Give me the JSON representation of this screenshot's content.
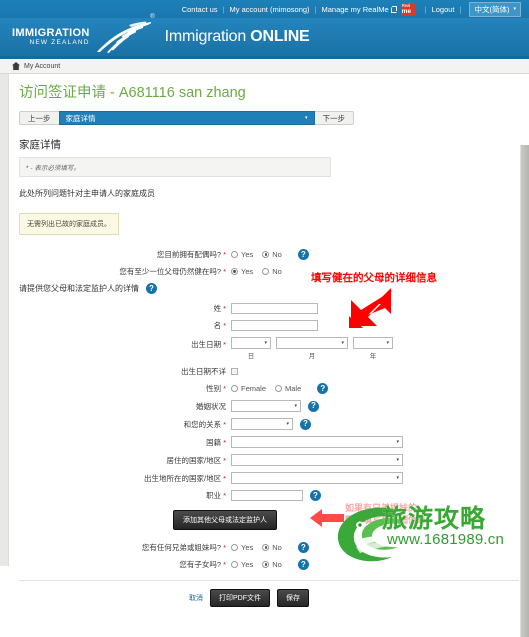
{
  "topbar": {
    "links": [
      {
        "label": "Contact us",
        "name": "contact-us-link"
      },
      {
        "label": "My account (mimosong)",
        "name": "my-account-link"
      },
      {
        "label": "Manage my RealMe",
        "name": "manage-realme-link"
      },
      {
        "label": "Logout",
        "name": "logout-link"
      }
    ],
    "separator": "|",
    "realme_badge_top": "Real",
    "realme_badge_bottom": "me",
    "language": "中文(简体)",
    "language_caret": "▾"
  },
  "brand": {
    "logo_line1": "IMMIGRATION",
    "logo_line2": "NEW ZEALAND",
    "registered_mark": "®",
    "site_title_light": "Immigration ",
    "site_title_bold": "ONLINE"
  },
  "breadcrumb": {
    "home_icon": "home-icon",
    "label": "My Account"
  },
  "page": {
    "title": "访问签证申请 - A681116 san zhang"
  },
  "stepnav": {
    "prev_label": "上一步",
    "current_step": "家庭详情",
    "caret": "▾",
    "next_label": "下一步"
  },
  "section": {
    "title": "家庭详情",
    "required_note_star": "*",
    "required_note": "- 表示必须填写。",
    "intro": "此处所列问题针对主申请人的家庭成员",
    "tip": "无需列出已故的家庭成员。"
  },
  "questions": {
    "spouse": {
      "label": "您目前拥有配偶吗?",
      "yes": "Yes",
      "no": "No",
      "selected": "No",
      "help": "help-icon"
    },
    "parent_alive": {
      "label": "您有至少一位父母仍然健在吗?",
      "yes": "Yes",
      "no": "No",
      "selected": "Yes"
    },
    "siblings": {
      "label": "您有任何兄弟或姐妹吗?",
      "yes": "Yes",
      "no": "No",
      "selected": "No",
      "help": "help-icon"
    },
    "children": {
      "label": "您有子女吗?",
      "yes": "Yes",
      "no": "No",
      "selected": "No",
      "help": "help-icon"
    }
  },
  "parent_form": {
    "heading": "请提供您父母和法定监护人的详情",
    "fields": {
      "surname": {
        "label": "姓",
        "required": "*",
        "value": ""
      },
      "given_name": {
        "label": "名",
        "required": "*",
        "value": ""
      },
      "dob": {
        "label": "出生日期",
        "required": "*",
        "day_value": "",
        "month_value": "",
        "year_value": "",
        "day_sub": "日",
        "month_sub": "月",
        "year_sub": "年"
      },
      "dob_unknown": {
        "label": "出生日期不详",
        "checked": false
      },
      "gender": {
        "label": "性别",
        "required": "*",
        "female": "Female",
        "male": "Male",
        "selected": ""
      },
      "marital_status": {
        "label": "婚姻状况",
        "required": "",
        "value": ""
      },
      "relationship": {
        "label": "和您的关系",
        "required": "*",
        "value": ""
      },
      "nationality": {
        "label": "国籍",
        "required": "*",
        "value": ""
      },
      "country_residence": {
        "label": "居住的国家/地区",
        "required": "*",
        "value": ""
      },
      "country_birth": {
        "label": "出生地所在的国家/地区",
        "required": "*",
        "value": ""
      },
      "occupation": {
        "label": "职业",
        "required": "*",
        "value": ""
      }
    },
    "add_button": "添加其他父母或法定监护人"
  },
  "footer": {
    "cancel": "取消",
    "print_pdf": "打印PDF文件",
    "save": "保存"
  },
  "annotations": {
    "parents_note": "填写健在的父母的详细信息",
    "siblings_note_line1": "如果有兄弟姐妹的",
    "siblings_note_line2": "需要填写其详细信息",
    "arrow_color": "#ff0000"
  },
  "watermark": {
    "text": "旅游攻略",
    "url": "www.1681989.cn",
    "color": "#39a935"
  },
  "colors": {
    "brand_blue": "#2081b9",
    "topbar_blue": "#1c7fb8",
    "title_green": "#6bab45",
    "help_blue": "#1673a8",
    "required_red": "#c02020",
    "annotation_red": "#ff0000"
  }
}
